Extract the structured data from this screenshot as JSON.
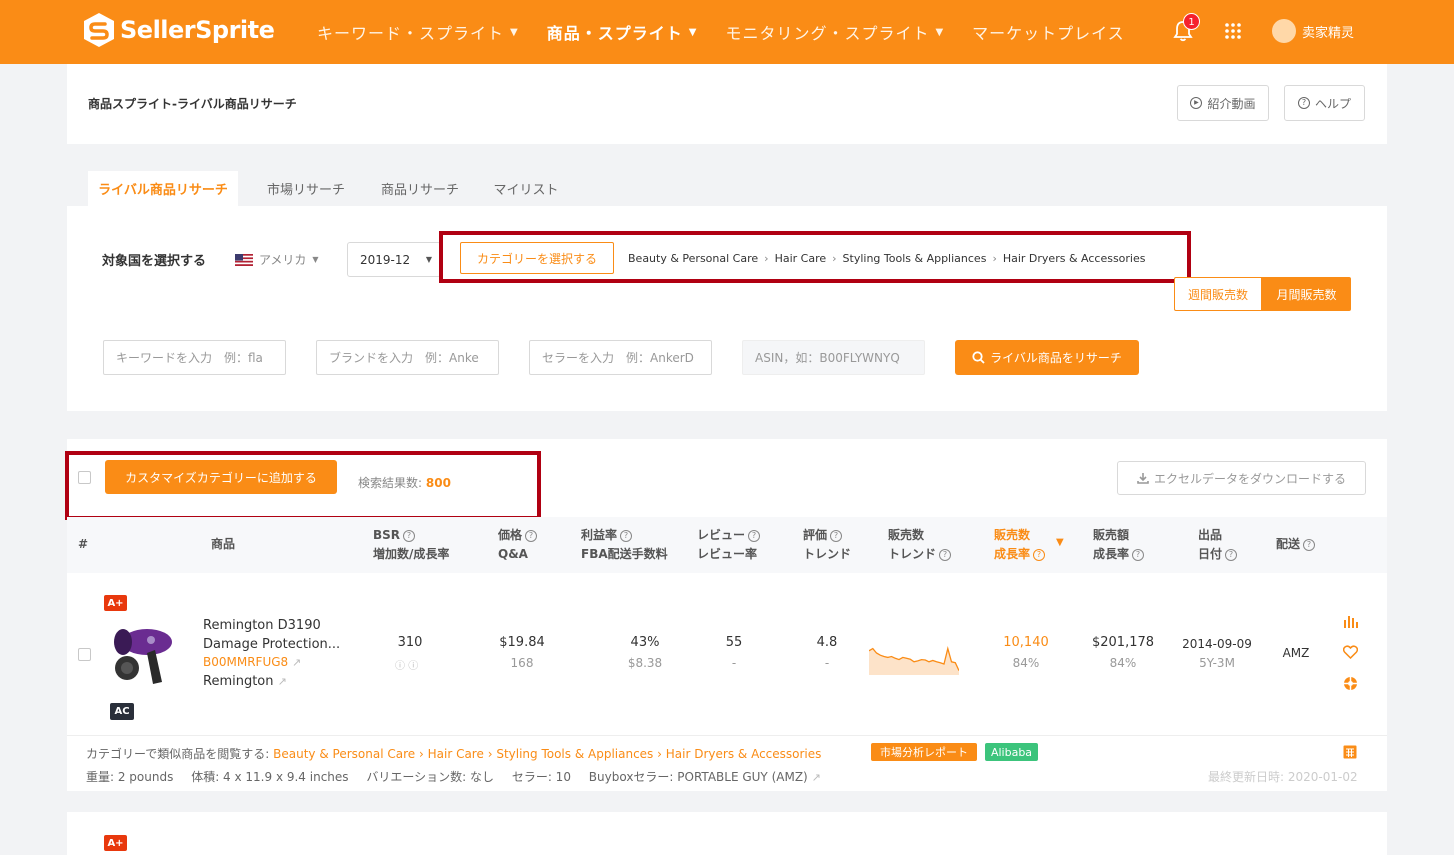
{
  "brand": {
    "name": "SellerSprite",
    "accent": "#fa8c16",
    "highlight": "#b00012"
  },
  "nav": {
    "items": [
      {
        "label": "キーワード・スプライト",
        "chevron": true,
        "active": false
      },
      {
        "label": "商品・スプライト",
        "chevron": true,
        "active": true
      },
      {
        "label": "モニタリング・スプライト",
        "chevron": true,
        "active": false
      },
      {
        "label": "マーケットプレイス",
        "chevron": false,
        "active": false
      }
    ],
    "notification_count": "1",
    "user_name": "卖家精灵"
  },
  "header": {
    "title": "商品スプライト-ライバル商品リサーチ",
    "intro_video": "紹介動画",
    "help": "ヘルプ"
  },
  "tabs": [
    "ライバル商品リサーチ",
    "市場リサーチ",
    "商品リサーチ",
    "マイリスト"
  ],
  "filter": {
    "country_label": "対象国を選択する",
    "country": "アメリカ",
    "month": "2019-12",
    "category_button": "カテゴリーを選択する",
    "breadcrumb": [
      "Beauty & Personal Care",
      "Hair Care",
      "Styling Tools & Appliances",
      "Hair Dryers & Accessories"
    ],
    "weekly_sales": "週間販売数",
    "monthly_sales": "月間販売数",
    "keyword_placeholder": "キーワードを入力　例：fla",
    "brand_placeholder": "ブランドを入力　例：Anke",
    "seller_placeholder": "セラーを入力　例：AnkerD",
    "asin_placeholder": "ASIN，如：B00FLYWNYQ",
    "search_button": "ライバル商品をリサーチ"
  },
  "results": {
    "add_button": "カスタマイズカテゴリーに追加する",
    "count_label": "検索結果数:",
    "count": "800",
    "download_button": "エクセルデータをダウンロードする"
  },
  "table": {
    "headers": {
      "num": "#",
      "product": "商品",
      "bsr": [
        "BSR",
        "増加数/成長率"
      ],
      "price": [
        "価格",
        "Q&A"
      ],
      "profit": [
        "利益率",
        "FBA配送手数料"
      ],
      "review": [
        "レビュー",
        "レビュー率"
      ],
      "rating": [
        "評価",
        "トレンド"
      ],
      "sales_trend": [
        "販売数",
        "トレンド"
      ],
      "sales_growth": [
        "販売数",
        "成長率"
      ],
      "revenue": [
        "販売額",
        "成長率"
      ],
      "listing": [
        "出品",
        "日付"
      ],
      "delivery": "配送"
    },
    "row": {
      "badge_top": "A+",
      "badge_bottom": "AC",
      "title_line1": "Remington D3190",
      "title_line2": "Damage Protection...",
      "asin": "B00MMRFUG8",
      "brand": "Remington",
      "bsr": "310",
      "price": "$19.84",
      "qa": "168",
      "profit": "43%",
      "fba_fee": "$8.38",
      "reviews": "55",
      "review_rate": "-",
      "rating": "4.8",
      "rating_trend": "-",
      "sales_trend": [
        0.55,
        0.6,
        0.5,
        0.45,
        0.42,
        0.4,
        0.42,
        0.38,
        0.35,
        0.4,
        0.38,
        0.36,
        0.3,
        0.32,
        0.35,
        0.34,
        0.3,
        0.33,
        0.3,
        0.28,
        0.25,
        0.6,
        0.3,
        0.28,
        0.1
      ],
      "sales": "10,140",
      "sales_growth": "84%",
      "revenue": "$201,178",
      "revenue_growth": "84%",
      "listing_date": "2014-09-09",
      "listing_age": "5Y-3M",
      "delivery": "AMZ"
    },
    "footer": {
      "similar_label": "カテゴリーで類似商品を閲覧する:",
      "market_report": "市場分析レポート",
      "alibaba": "Alibaba",
      "weight": "重量: 2 pounds",
      "volume": "体積: 4 x 11.9 x 9.4 inches",
      "variations": "バリエーション数: なし",
      "sellers": "セラー: 10",
      "buybox": "Buyboxセラー: PORTABLE GUY (AMZ)",
      "updated": "最終更新日時: 2020-01-02"
    },
    "next_badge": "A+"
  }
}
